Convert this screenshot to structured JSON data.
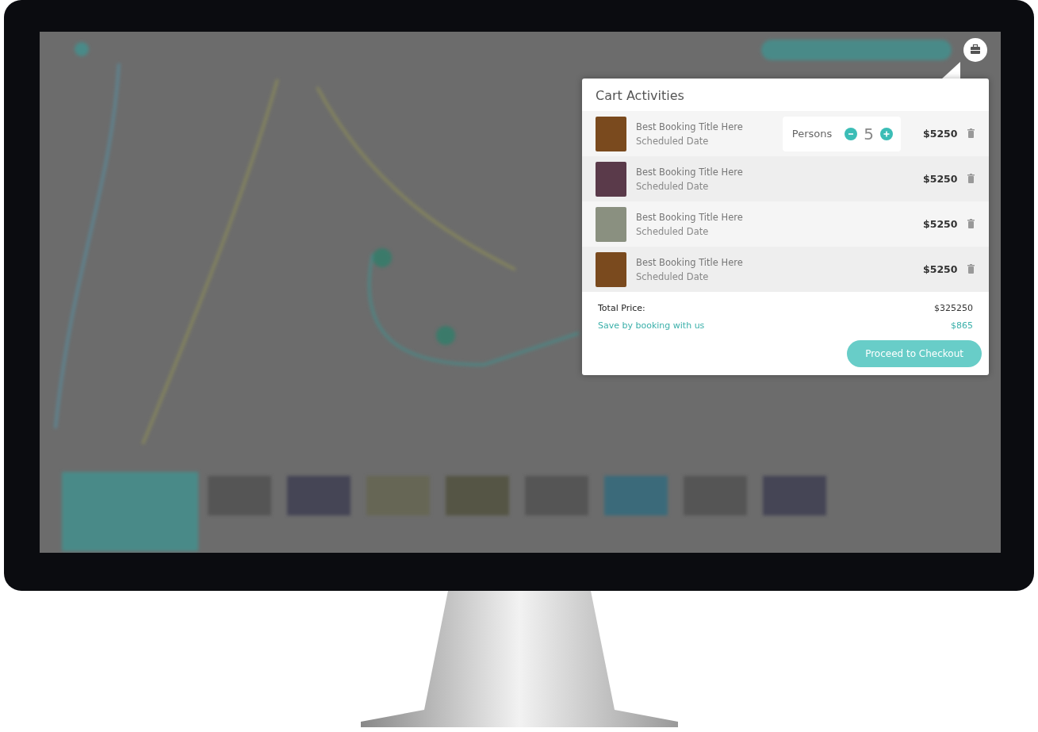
{
  "cart": {
    "title": "Cart Activities",
    "items": [
      {
        "title": "Best Booking Title Here",
        "date": "Scheduled Date",
        "persons": {
          "label": "Persons",
          "count": "5"
        },
        "price": "$5250"
      },
      {
        "title": "Best Booking Title Here",
        "date": "Scheduled Date",
        "price": "$5250"
      },
      {
        "title": "Best Booking Title Here",
        "date": "Scheduled Date",
        "price": "$5250"
      },
      {
        "title": "Best Booking Title Here",
        "date": "Scheduled Date",
        "price": "$5250"
      }
    ],
    "total_label": "Total Price:",
    "total": "$325250",
    "savings_label": "Save by booking with us",
    "savings": "$865",
    "checkout_button": "Proceed to Checkout"
  }
}
